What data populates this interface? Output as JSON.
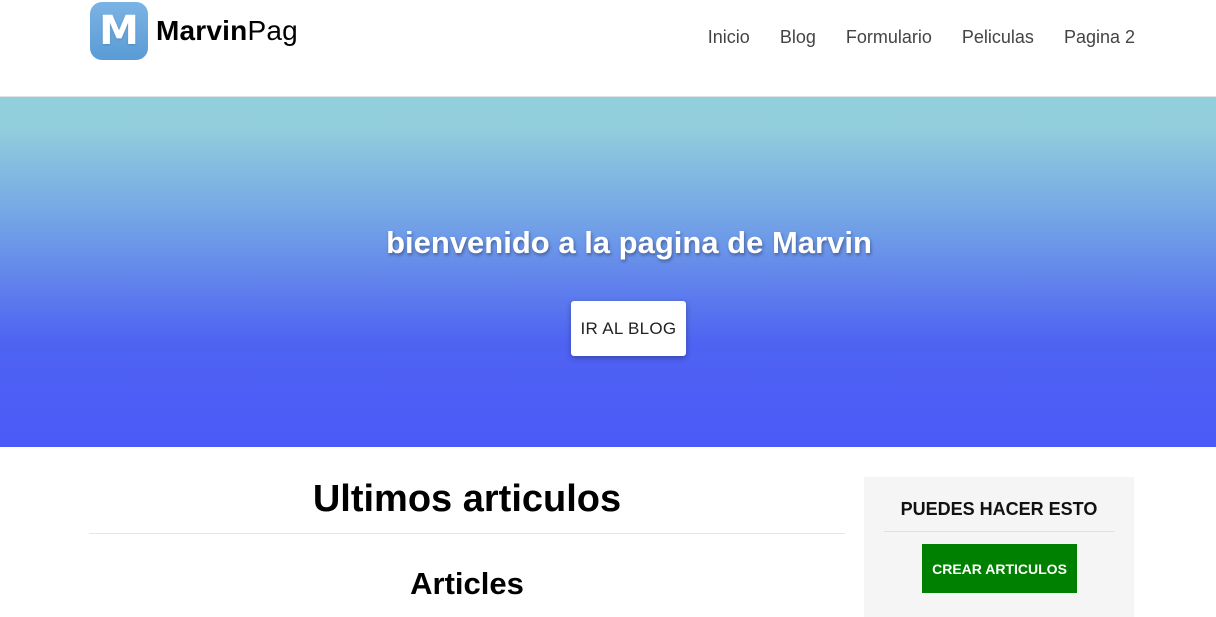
{
  "header": {
    "logo_letter": "M",
    "logo_bold": "Marvin",
    "logo_light": "Pag",
    "nav": [
      "Inicio",
      "Blog",
      "Formulario",
      "Peliculas",
      "Pagina 2"
    ]
  },
  "hero": {
    "title": "bienvenido a la pagina de Marvin",
    "button_label": "IR AL BLOG"
  },
  "main": {
    "section_title": "Ultimos articulos",
    "sub_title": "Articles"
  },
  "sidebar": {
    "title": "PUEDES HACER ESTO",
    "button_label": "CREAR ARTICULOS"
  },
  "colors": {
    "logo_badge": "#5a9bd6",
    "hero_top": "#92cfdc",
    "hero_bottom": "#4a5af8",
    "create_button": "#008000",
    "sidebar_bg": "#f5f5f5"
  }
}
